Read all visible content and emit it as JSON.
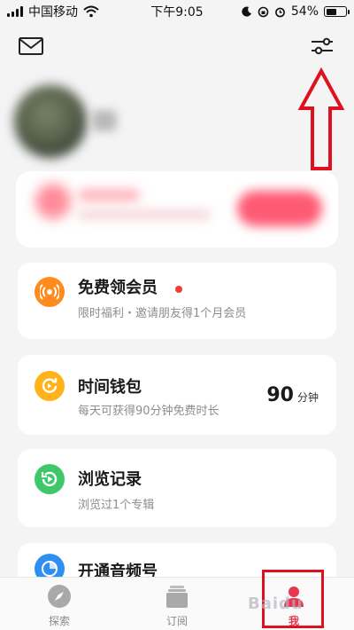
{
  "status_bar": {
    "carrier": "中国移动",
    "time": "下午9:05",
    "battery_percent": "54%",
    "battery_level": 0.54
  },
  "header": {
    "left_icon": "mail-icon",
    "right_icon": "settings-sliders-icon"
  },
  "menu_items": [
    {
      "title": "免费领会员",
      "subtitle": "限时福利・邀请朋友得1个月会员",
      "icon": "broadcast-icon",
      "icon_color": "#ff8a1e",
      "has_red_dot": true
    },
    {
      "title": "时间钱包",
      "subtitle": "每天可获得90分钟免费时长",
      "icon": "clock-refresh-icon",
      "icon_color": "#ffb21a",
      "value": "90",
      "value_unit": "分钟"
    },
    {
      "title": "浏览记录",
      "subtitle": "浏览过1个专辑",
      "icon": "history-play-icon",
      "icon_color": "#3ec86a"
    },
    {
      "title": "开通音频号",
      "icon": "audio-icon",
      "icon_color": "#2f8ff0"
    }
  ],
  "tabs": [
    {
      "label": "探索",
      "icon": "compass-icon",
      "active": false
    },
    {
      "label": "订阅",
      "icon": "stack-icon",
      "active": false
    },
    {
      "label": "我",
      "icon": "user-icon",
      "active": true
    }
  ],
  "colors": {
    "accent": "#e8364f",
    "annotation_red": "#e0111f",
    "background": "#f4f4f5"
  },
  "watermark": "Baidu"
}
